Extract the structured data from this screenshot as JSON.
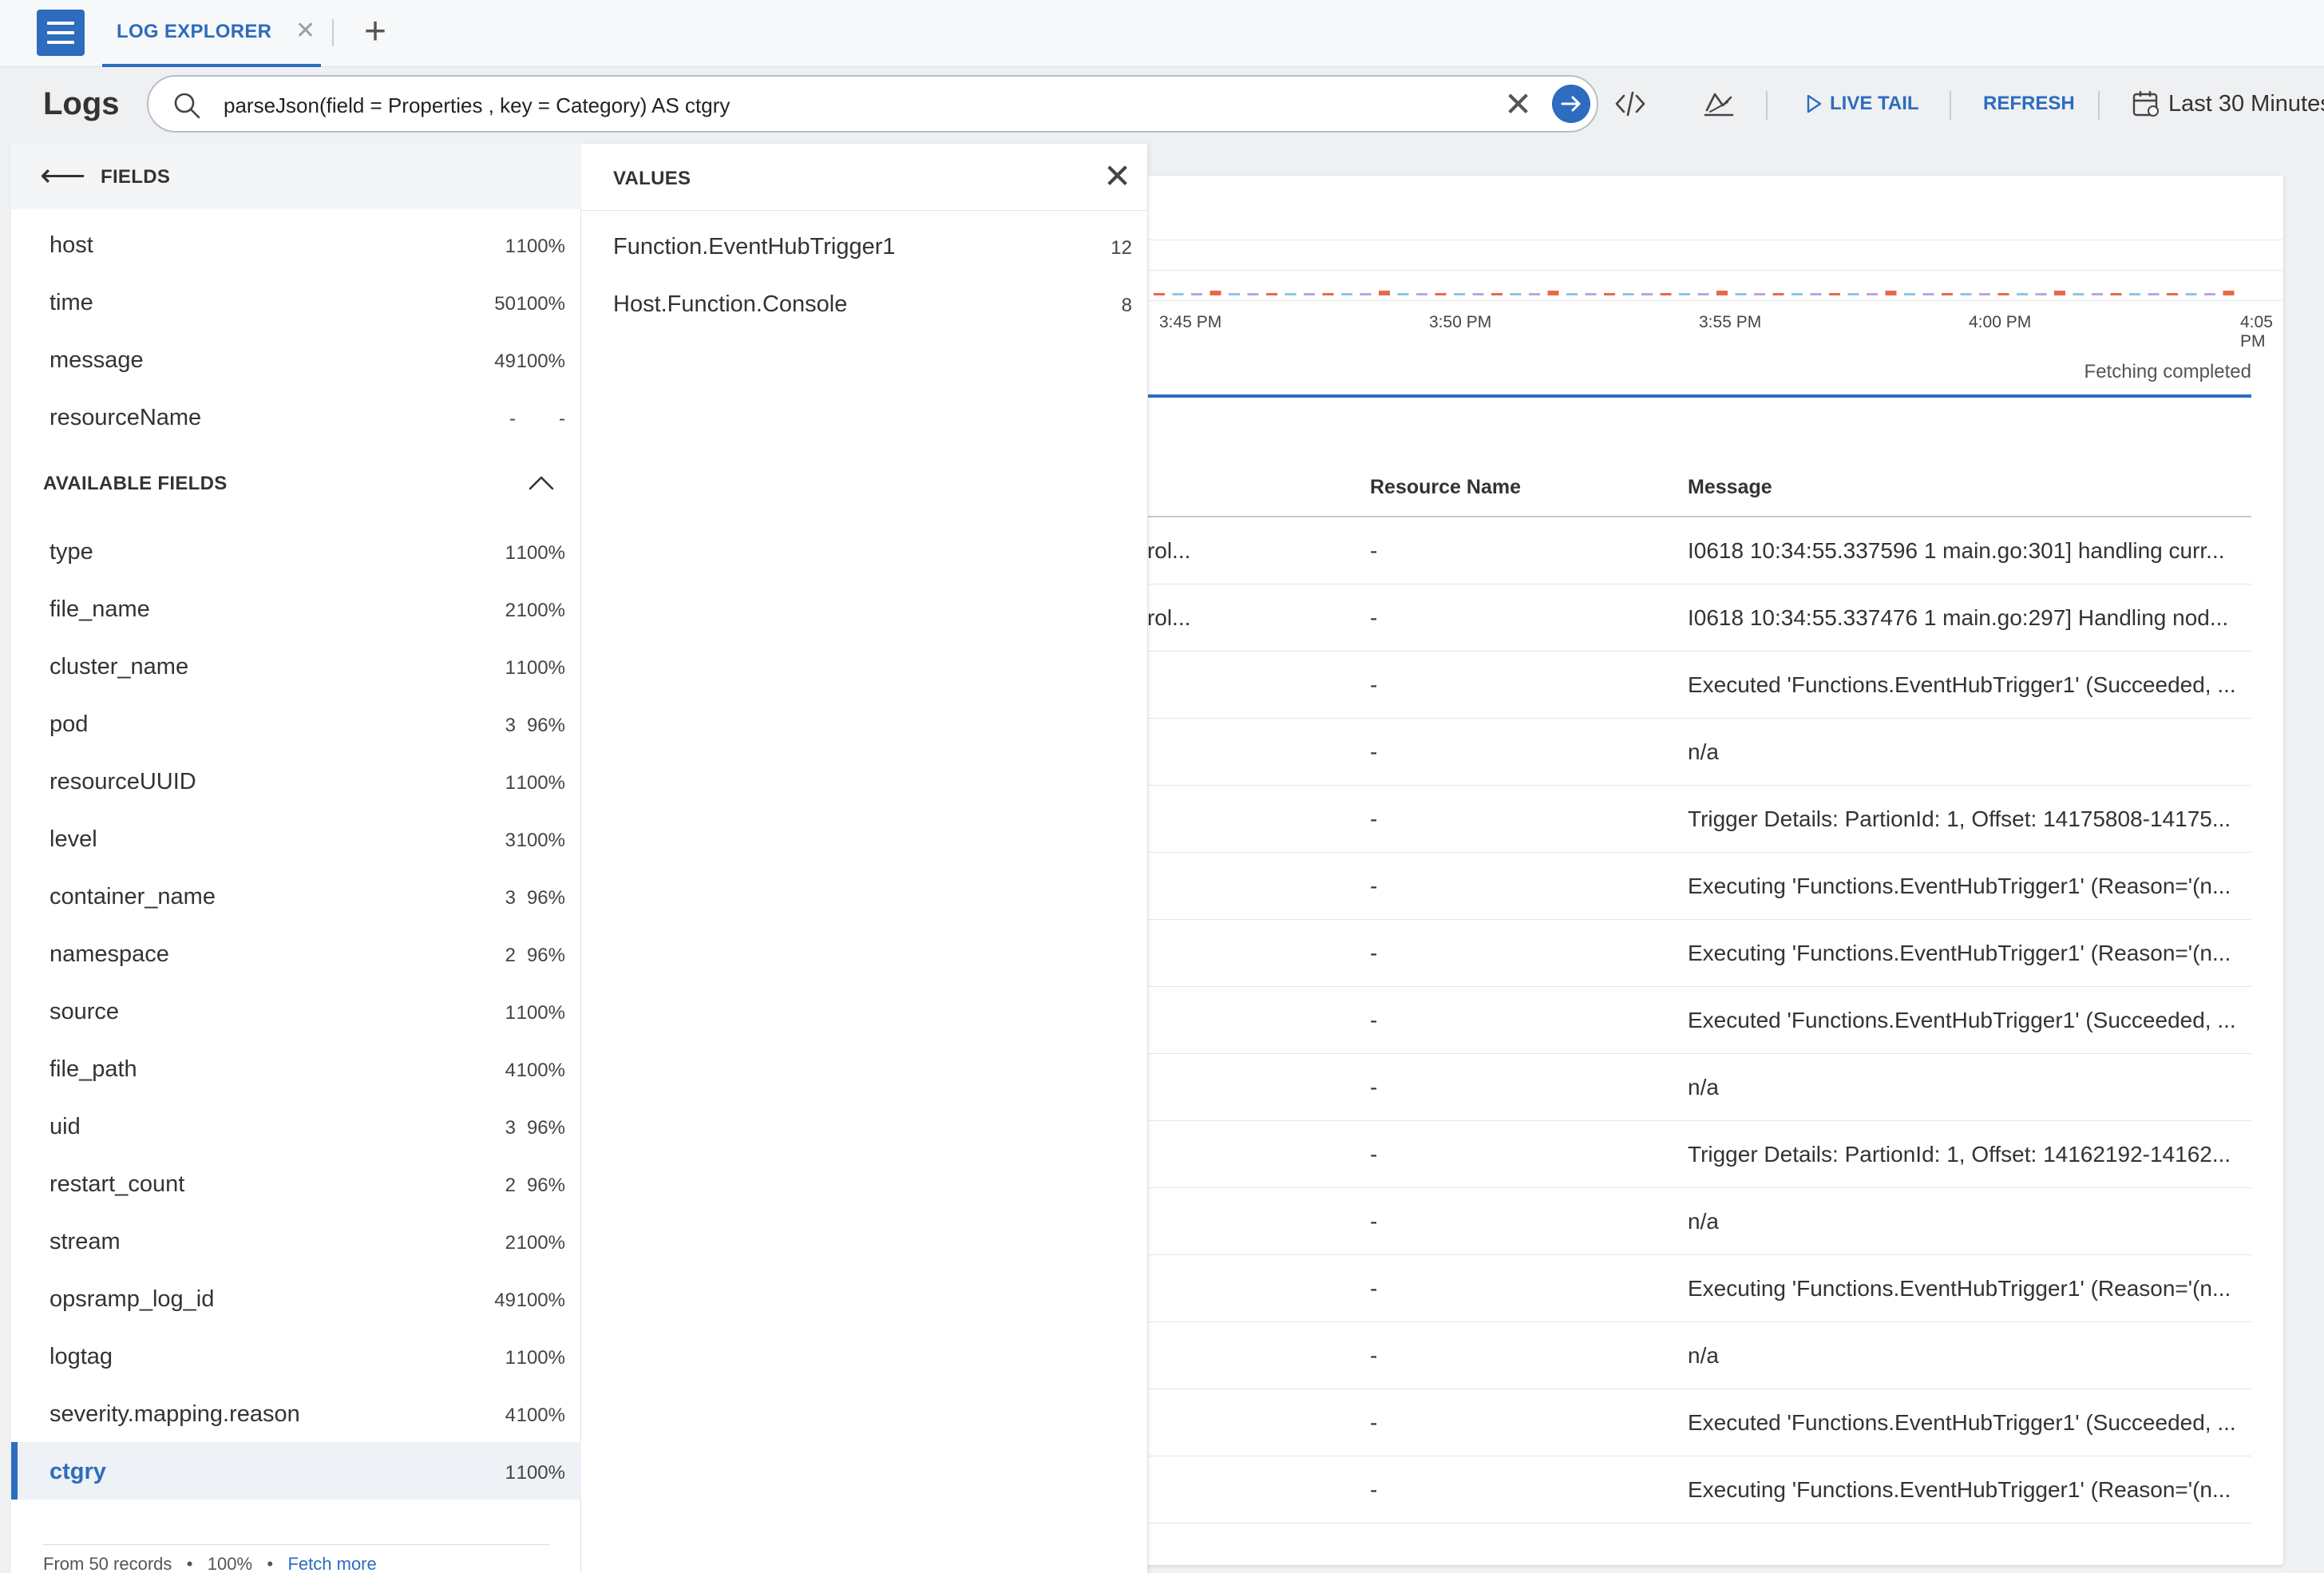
{
  "tabbar": {
    "tab_label": "LOG EXPLORER",
    "close_glyph": "✕",
    "add_glyph": "+"
  },
  "header": {
    "title": "Logs",
    "search_value": "parseJson(field = Properties , key = Category) AS ctgry",
    "clear_glyph": "✕",
    "live_tail_label": "LIVE TAIL",
    "refresh_label": "REFRESH",
    "time_range": "Last 30 Minutes"
  },
  "histogram": {
    "ticks": [
      "3:45 PM",
      "3:50 PM",
      "3:55 PM",
      "4:00 PM",
      "4:05 PM"
    ],
    "status": "Fetching completed"
  },
  "table": {
    "columns": [
      "Resource Name",
      "Message"
    ],
    "rows": [
      {
        "c1": "c-logs-control...",
        "resource": "-",
        "message": "I0618 10:34:55.337596 1 main.go:301] handling curr..."
      },
      {
        "c1": "c-logs-control...",
        "resource": "-",
        "message": "I0618 10:34:55.337476 1 main.go:297] Handling nod..."
      },
      {
        "c1": "",
        "resource": "-",
        "message": "Executed 'Functions.EventHubTrigger1' (Succeeded, ..."
      },
      {
        "c1": "",
        "resource": "-",
        "message": "n/a"
      },
      {
        "c1": "",
        "resource": "-",
        "message": "Trigger Details: PartionId: 1, Offset: 14175808-14175..."
      },
      {
        "c1": "",
        "resource": "-",
        "message": "Executing 'Functions.EventHubTrigger1' (Reason='(n..."
      },
      {
        "c1": "",
        "resource": "-",
        "message": "Executing 'Functions.EventHubTrigger1' (Reason='(n..."
      },
      {
        "c1": "",
        "resource": "-",
        "message": "Executed 'Functions.EventHubTrigger1' (Succeeded, ..."
      },
      {
        "c1": "",
        "resource": "-",
        "message": "n/a"
      },
      {
        "c1": "",
        "resource": "-",
        "message": "Trigger Details: PartionId: 1, Offset: 14162192-14162..."
      },
      {
        "c1": "",
        "resource": "-",
        "message": "n/a"
      },
      {
        "c1": "",
        "resource": "-",
        "message": "Executing 'Functions.EventHubTrigger1' (Reason='(n..."
      },
      {
        "c1": "",
        "resource": "-",
        "message": "n/a"
      },
      {
        "c1": "",
        "resource": "-",
        "message": "Executed 'Functions.EventHubTrigger1' (Succeeded, ..."
      },
      {
        "c1": "",
        "resource": "-",
        "message": "Executing 'Functions.EventHubTrigger1' (Reason='(n..."
      }
    ]
  },
  "fields": {
    "title": "FIELDS",
    "selected": [
      {
        "name": "host",
        "count": "1",
        "pct": "100%"
      },
      {
        "name": "time",
        "count": "50",
        "pct": "100%"
      },
      {
        "name": "message",
        "count": "49",
        "pct": "100%"
      },
      {
        "name": "resourceName",
        "count": "-",
        "pct": "-"
      }
    ],
    "available_title": "AVAILABLE FIELDS",
    "available": [
      {
        "name": "type",
        "count": "1",
        "pct": "100%"
      },
      {
        "name": "file_name",
        "count": "2",
        "pct": "100%"
      },
      {
        "name": "cluster_name",
        "count": "1",
        "pct": "100%"
      },
      {
        "name": "pod",
        "count": "3",
        "pct": "96%"
      },
      {
        "name": "resourceUUID",
        "count": "1",
        "pct": "100%"
      },
      {
        "name": "level",
        "count": "3",
        "pct": "100%"
      },
      {
        "name": "container_name",
        "count": "3",
        "pct": "96%"
      },
      {
        "name": "namespace",
        "count": "2",
        "pct": "96%"
      },
      {
        "name": "source",
        "count": "1",
        "pct": "100%"
      },
      {
        "name": "file_path",
        "count": "4",
        "pct": "100%"
      },
      {
        "name": "uid",
        "count": "3",
        "pct": "96%"
      },
      {
        "name": "restart_count",
        "count": "2",
        "pct": "96%"
      },
      {
        "name": "stream",
        "count": "2",
        "pct": "100%"
      },
      {
        "name": "opsramp_log_id",
        "count": "49",
        "pct": "100%"
      },
      {
        "name": "logtag",
        "count": "1",
        "pct": "100%"
      },
      {
        "name": "severity.mapping.reason",
        "count": "4",
        "pct": "100%"
      },
      {
        "name": "ctgry",
        "count": "1",
        "pct": "100%"
      }
    ],
    "footer_records": "From 50 records",
    "footer_pct": "100%",
    "footer_link": "Fetch more"
  },
  "values": {
    "title": "VALUES",
    "close_glyph": "✕",
    "items": [
      {
        "name": "Function.EventHubTrigger1",
        "count": "12"
      },
      {
        "name": "Host.Function.Console",
        "count": "8"
      }
    ]
  },
  "colors": {
    "accent": "#2d6cbf",
    "hist_bar_a": "#e8694a",
    "hist_bar_b": "#8fc4e8",
    "hist_bar_c": "#b9a7e2"
  },
  "icons": {
    "menu": "hamburger-icon",
    "search": "search-icon",
    "go": "arrow-right-circle-icon",
    "code": "code-icon",
    "chart": "chart-icon",
    "play": "play-icon",
    "calendar": "calendar-icon",
    "back": "arrow-left-icon",
    "toggle": "chevron-up-icon",
    "close": "close-icon"
  }
}
